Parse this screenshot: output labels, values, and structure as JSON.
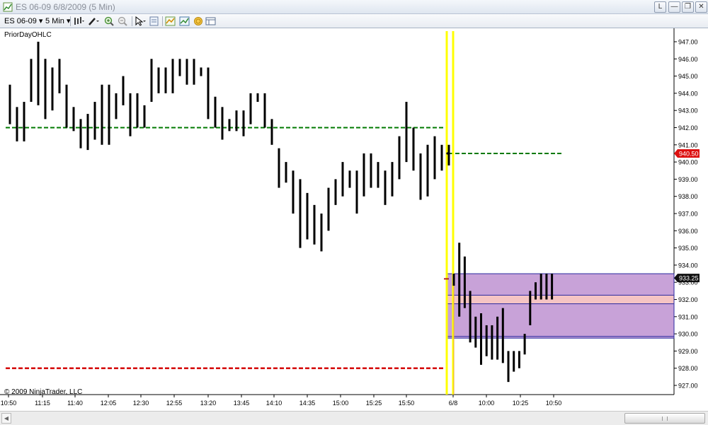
{
  "window": {
    "title": "ES 06-09  6/8/2009 (5 Min)",
    "buttons": {
      "l": "L",
      "minimize": "—",
      "maximize": "❐",
      "close": "✕"
    }
  },
  "toolbar": {
    "instrument": "ES 06-09 ▾",
    "period": "5 Min ▾",
    "icons": [
      "bar-type-icon",
      "draw-pencil-icon",
      "zoom-in-icon",
      "zoom-out-icon",
      "cursor-icon",
      "properties-icon",
      "indicators-icon",
      "strategies-icon",
      "coins-icon",
      "data-box-icon"
    ]
  },
  "chart": {
    "indicator_label": "PriorDayOHLC",
    "copyright": "© 2009 NinjaTrader, LLC",
    "colors": {
      "bars": "#000000",
      "prior_close": "#007a00",
      "prior_low": "#d40000",
      "session_break": "#ffff00",
      "range_box_fill": "#c8a2d8",
      "range_box_border": "#2a2aa0",
      "inner_band": "#f5c4c4",
      "last_price_tag": "#dd1010",
      "marker_tag": "#111111"
    }
  },
  "chart_data": {
    "type": "ohlc",
    "y_axis": {
      "range": [
        926.5,
        947.5
      ],
      "ticks": [
        "947.00",
        "946.00",
        "945.00",
        "944.00",
        "943.00",
        "942.00",
        "941.00",
        "940.00",
        "939.00",
        "938.00",
        "937.00",
        "936.00",
        "935.00",
        "934.00",
        "933.00",
        "932.00",
        "931.00",
        "930.00",
        "929.00",
        "928.00",
        "927.00"
      ]
    },
    "x_axis": {
      "labels": [
        "10:50",
        "11:15",
        "11:40",
        "12:05",
        "12:30",
        "12:55",
        "13:20",
        "13:45",
        "14:10",
        "14:35",
        "15:00",
        "15:25",
        "15:50",
        "6/8",
        "10:00",
        "10:25",
        "10:50"
      ]
    },
    "price_tags": {
      "last_price": "940.50",
      "marker_price": "933.25"
    },
    "levels": {
      "prior_close": 942.0,
      "prior_low": 928.0,
      "current_open_level": 940.5,
      "range_box": [
        929.75,
        933.5
      ],
      "inner_band": [
        931.75,
        932.25
      ]
    },
    "bars_prior": [
      [
        944.5,
        942.2
      ],
      [
        943.2,
        941.2
      ],
      [
        943.5,
        941.2
      ],
      [
        946.0,
        943.5
      ],
      [
        947.0,
        943.3
      ],
      [
        946.0,
        942.5
      ],
      [
        945.5,
        943.0
      ],
      [
        946.0,
        944.0
      ],
      [
        944.5,
        942.0
      ],
      [
        943.2,
        941.8
      ],
      [
        942.5,
        940.8
      ],
      [
        942.8,
        940.7
      ],
      [
        943.5,
        941.3
      ],
      [
        944.5,
        941.0
      ],
      [
        944.5,
        941.0
      ],
      [
        944.0,
        942.5
      ],
      [
        945.0,
        943.3
      ],
      [
        944.0,
        941.5
      ],
      [
        944.0,
        942.0
      ],
      [
        943.3,
        942.0
      ],
      [
        946.0,
        943.5
      ],
      [
        945.5,
        944.0
      ],
      [
        945.5,
        944.0
      ],
      [
        946.0,
        944.0
      ],
      [
        946.0,
        945.0
      ],
      [
        946.0,
        944.5
      ],
      [
        946.0,
        944.5
      ],
      [
        945.5,
        945.0
      ],
      [
        945.5,
        942.5
      ],
      [
        943.8,
        942.0
      ],
      [
        943.2,
        941.3
      ],
      [
        942.5,
        941.8
      ],
      [
        943.0,
        941.8
      ],
      [
        943.0,
        941.5
      ],
      [
        944.0,
        942.2
      ],
      [
        944.0,
        943.5
      ],
      [
        944.0,
        942.0
      ],
      [
        942.5,
        941.0
      ],
      [
        940.8,
        938.5
      ],
      [
        940.0,
        938.8
      ],
      [
        939.5,
        937.0
      ],
      [
        939.0,
        935.0
      ],
      [
        938.2,
        935.5
      ],
      [
        937.5,
        935.2
      ],
      [
        937.0,
        934.8
      ],
      [
        938.5,
        936.0
      ],
      [
        939.0,
        937.5
      ],
      [
        940.0,
        938.0
      ],
      [
        939.5,
        938.5
      ],
      [
        939.5,
        937.0
      ],
      [
        940.5,
        938.0
      ],
      [
        940.5,
        938.5
      ],
      [
        940.0,
        938.5
      ],
      [
        939.5,
        937.5
      ],
      [
        940.0,
        938.0
      ],
      [
        941.5,
        939.0
      ],
      [
        943.5,
        940.0
      ],
      [
        942.0,
        939.5
      ],
      [
        940.5,
        937.8
      ],
      [
        941.0,
        938.0
      ],
      [
        941.5,
        939.0
      ],
      [
        941.0,
        939.5
      ],
      [
        941.0,
        939.8
      ]
    ],
    "bars_session": [
      [
        933.5,
        932.8
      ],
      [
        935.3,
        931.0
      ],
      [
        934.5,
        931.5
      ],
      [
        932.5,
        929.5
      ],
      [
        931.0,
        929.2
      ],
      [
        931.2,
        928.2
      ],
      [
        930.5,
        928.7
      ],
      [
        930.5,
        928.5
      ],
      [
        931.0,
        928.5
      ],
      [
        931.5,
        928.3
      ],
      [
        929.0,
        927.2
      ],
      [
        929.0,
        927.8
      ],
      [
        929.0,
        928.0
      ],
      [
        930.0,
        928.8
      ],
      [
        932.5,
        930.5
      ],
      [
        933.0,
        932.0
      ],
      [
        933.5,
        932.0
      ],
      [
        933.5,
        932.0
      ],
      [
        933.5,
        932.0
      ]
    ]
  }
}
